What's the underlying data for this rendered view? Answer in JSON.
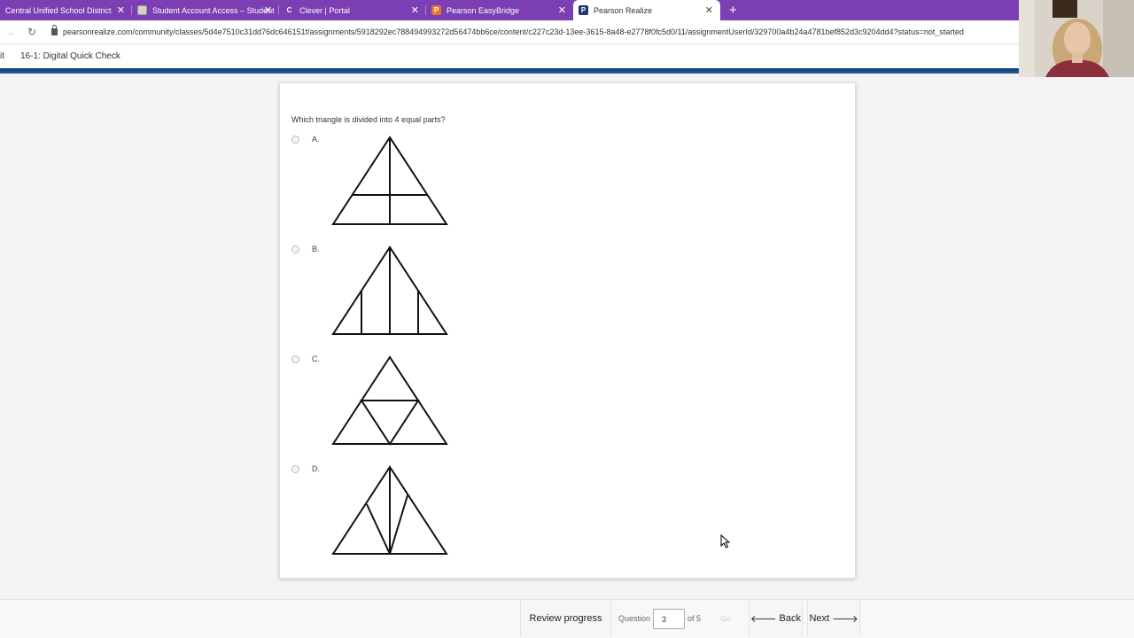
{
  "browser": {
    "tabs": [
      {
        "title": "Central Unified School District",
        "favicon": "school-icon",
        "active": false
      },
      {
        "title": "Student Account Access – Student",
        "favicon": "account-icon",
        "active": false
      },
      {
        "title": "Clever | Portal",
        "favicon": "clever-icon",
        "active": false
      },
      {
        "title": "Pearson EasyBridge",
        "favicon": "pearson-icon",
        "active": false
      },
      {
        "title": "Pearson Realize",
        "favicon": "pearson-realize-icon",
        "active": true
      }
    ],
    "new_tab": "+",
    "close_glyph": "✕",
    "url": "pearsonrealize.com/community/classes/5d4e7510c31dd76dc646151f/assignments/5918292ec788494993272d56474bb6ce/content/c227c23d-13ee-3615-8a48-e2778f0fc5d0/11/assignmentUserId/329700a4b24a4781bef852d3c9204dd4?status=not_started",
    "accent": "#7b3fb3"
  },
  "header": {
    "exit_label": "it",
    "assignment_title": "16-1: Digital Quick Check"
  },
  "question": {
    "prompt": "Which triangle is divided into 4 equal parts?",
    "options": [
      {
        "letter": "A.",
        "figure": "triangle-vertical-and-horizontal-split"
      },
      {
        "letter": "B.",
        "figure": "triangle-three-vertical-lines"
      },
      {
        "letter": "C.",
        "figure": "triangle-midpoint-subdivision"
      },
      {
        "letter": "D.",
        "figure": "triangle-diagonal-lines"
      }
    ]
  },
  "footer": {
    "review_label": "Review progress",
    "question_label": "Question",
    "current_question": "3",
    "of_label": "of 5",
    "go_label": "Go",
    "back_label": "Back",
    "next_label": "Next"
  }
}
